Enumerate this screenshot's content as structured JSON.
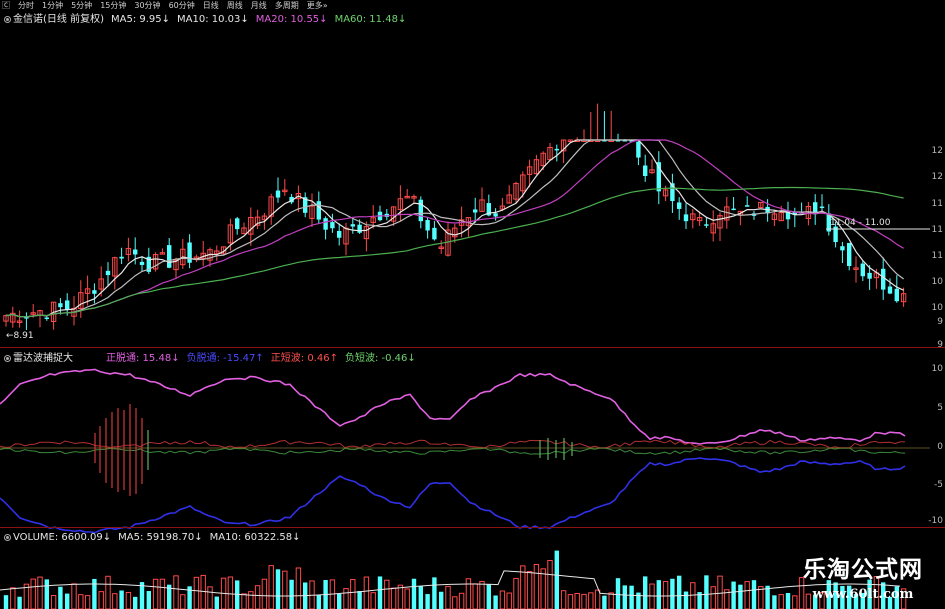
{
  "toolbar": {
    "tabs": [
      "🄲",
      "分时",
      "1分钟",
      "5分钟",
      "15分钟",
      "30分钟",
      "60分钟",
      "日线",
      "周线",
      "月线",
      "多周期",
      "更多"
    ],
    "more_arrow": "»"
  },
  "main_legend": {
    "title": "金信诺(日线 前复权)",
    "ma5": "MA5: 9.95",
    "ma10": "MA10: 10.03",
    "ma20": "MA20: 10.55",
    "ma60": "MA60: 11.48",
    "down_arrow": "↓"
  },
  "price_annotations": {
    "low_label": "8.91",
    "range_label": "11.04 - 11.00"
  },
  "price_axis": [
    "12",
    "12",
    "11",
    "11",
    "11",
    "10",
    "10",
    "9",
    "9"
  ],
  "radar_legend": {
    "title": "雷达波捕捉大",
    "pos_channel": "正脱通: 15.48",
    "neg_channel": "负脱通: -15.47",
    "pos_wave": "正短波: 0.46",
    "neg_wave": "负短波: -0.46",
    "down_arrow": "↓",
    "up_arrow": "↑"
  },
  "radar_axis": [
    "10",
    "5",
    "0",
    "-5",
    "-10"
  ],
  "volume_legend": {
    "title": "VOLUME: 6600.09",
    "ma5": "MA5: 59198.70",
    "ma10": "MA10: 60322.58",
    "down_arrow": "↓"
  },
  "watermark": {
    "title": "乐淘公式网",
    "url": "www.60lt.com"
  },
  "colors": {
    "up": "#ff4a4a",
    "down": "#54ffff",
    "ma5": "#e8e8e8",
    "ma10": "#e8e8e8",
    "ma20": "#c040c0",
    "ma60": "#4caf50",
    "pos_channel": "#e060e0",
    "neg_channel": "#3030e8",
    "separator": "#8a1414"
  }
}
